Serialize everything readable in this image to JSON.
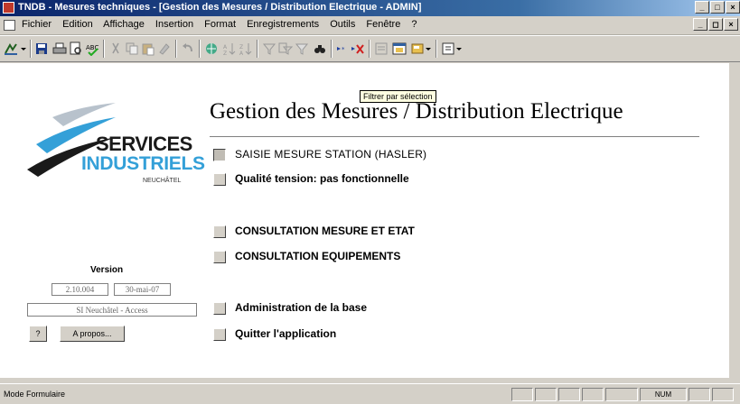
{
  "window": {
    "title": "TNDB - Mesures techniques - [Gestion des Mesures / Distribution Electrique - ADMIN]"
  },
  "menubar": {
    "items": [
      "Fichier",
      "Edition",
      "Affichage",
      "Insertion",
      "Format",
      "Enregistrements",
      "Outils",
      "Fenêtre",
      "?"
    ]
  },
  "tooltip": "Filtrer par sélection",
  "logo": {
    "line1": "SERVICES",
    "line2": "INDUSTRIELS",
    "line3": "NEUCHÂTEL"
  },
  "form": {
    "title": "Gestion des Mesures / Distribution Electrique",
    "options": [
      "SAISIE MESURE STATION (HASLER)",
      "Qualité tension: pas fonctionnelle",
      "CONSULTATION MESURE ET ETAT",
      "CONSULTATION EQUIPEMENTS",
      "Administration de la base",
      "Quitter l'application"
    ]
  },
  "version": {
    "label": "Version",
    "number": "2.10.004",
    "date": "30-mai-07"
  },
  "site": "SI Neuchâtel - Access",
  "buttons": {
    "help": "?",
    "about": "A propos..."
  },
  "status": {
    "mode": "Mode Formulaire",
    "num": "NUM"
  },
  "colors": {
    "title_bar": "#0a246a",
    "logo_blue": "#34a0d8",
    "logo_dark": "#1a1a1a"
  }
}
